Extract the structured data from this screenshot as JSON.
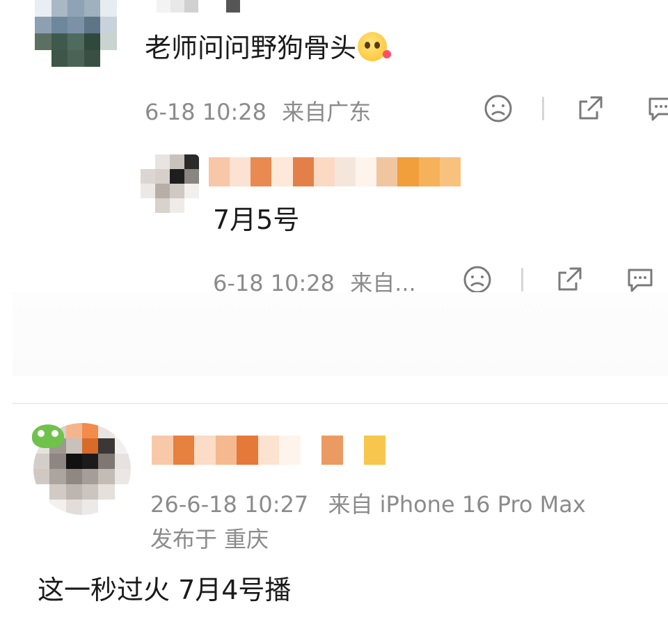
{
  "thread": {
    "comment": {
      "text": "老师问问野狗骨头",
      "emoji": "hug-face-emoji",
      "time": "6-18 10:28",
      "location": "来自广东"
    },
    "reply": {
      "text": "7月5号",
      "time": "6-18 10:28",
      "location": "来自..."
    }
  },
  "post": {
    "time": "26-6-18 10:27",
    "device": "来自 iPhone 16 Pro Max",
    "location": "发布于 重庆",
    "text": "这一秒过火 7月4号播"
  },
  "colors": {
    "meta_gray": "#8b8b8b",
    "text_dark": "#1a1a1a",
    "divider": "#ececec",
    "icon_gray": "#7a7a7a"
  }
}
